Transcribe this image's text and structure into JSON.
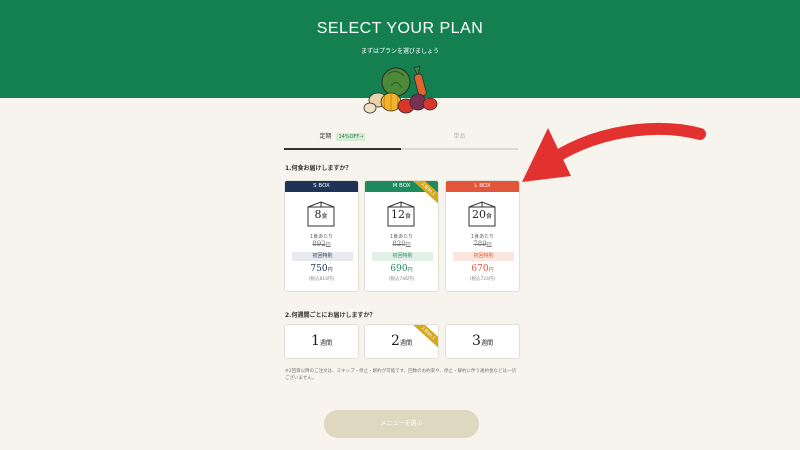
{
  "header": {
    "title": "SELECT YOUR PLAN",
    "subtitle": "まずはプランを選びましょう"
  },
  "tabs": [
    {
      "label": "定期",
      "badge": "14%OFF→",
      "active": true
    },
    {
      "label": "単品",
      "active": false
    }
  ],
  "question1": "1.何食お届けしますか？",
  "boxes": [
    {
      "name": "S BOX",
      "count": "8",
      "unit": "食",
      "per": "1食あたり",
      "old_price": "892",
      "old_unit": "円",
      "first_label": "初回特別",
      "price": "750",
      "price_unit": "円",
      "tax": "(税込810円)",
      "color": "#1f3357",
      "tint": "#e9eaef",
      "ribbon": ""
    },
    {
      "name": "M BOX",
      "count": "12",
      "unit": "食",
      "per": "1食あたり",
      "old_price": "820",
      "old_unit": "円",
      "first_label": "初回特別",
      "price": "690",
      "price_unit": "円",
      "tax": "(税込746円)",
      "color": "#1f8a5e",
      "tint": "#e3f0e8",
      "ribbon": "人気No.1"
    },
    {
      "name": "L BOX",
      "count": "20",
      "unit": "食",
      "per": "1食あたり",
      "old_price": "789",
      "old_unit": "円",
      "first_label": "初回特別",
      "price": "670",
      "price_unit": "円",
      "tax": "(税込724円)",
      "color": "#e2553a",
      "tint": "#fbe5df",
      "ribbon": ""
    }
  ],
  "question2": "2.何週間ごとにお届けしますか？",
  "frequencies": [
    {
      "num": "1",
      "unit": "週間",
      "ribbon": ""
    },
    {
      "num": "2",
      "unit": "週間",
      "ribbon": "人気No.1"
    },
    {
      "num": "3",
      "unit": "週間",
      "ribbon": ""
    }
  ],
  "note": "※2回目以降のご注文は、スキップ・停止・解約が可能です。回数のお約束や、停止・解約に伴う違約金などは一切ございません。",
  "cta_label": "メニューを選ぶ",
  "colors": {
    "brand_green": "#14804f",
    "arrow_red": "#e2312f",
    "ribbon_gold": "#d6a81c"
  },
  "icons": [
    "vegetables-illustration",
    "box-icon",
    "red-arrow-icon"
  ]
}
